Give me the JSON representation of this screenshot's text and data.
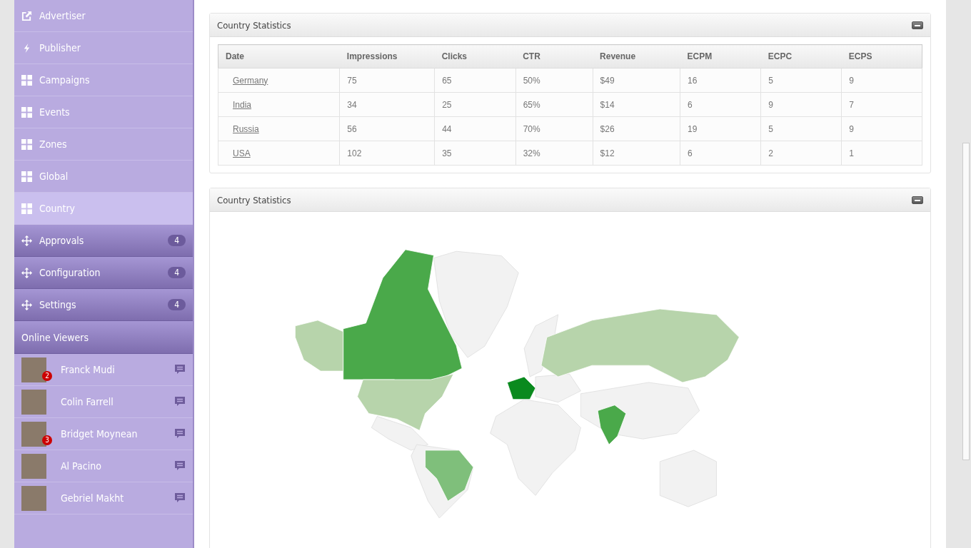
{
  "sidebar": {
    "items": [
      {
        "kind": "link",
        "label": "Advertiser",
        "selected": false
      },
      {
        "kind": "bolt",
        "label": "Publisher",
        "selected": false
      },
      {
        "kind": "grid",
        "label": "Campaigns",
        "selected": false
      },
      {
        "kind": "grid",
        "label": "Events",
        "selected": false
      },
      {
        "kind": "grid",
        "label": "Zones",
        "selected": false
      },
      {
        "kind": "grid",
        "label": "Global",
        "selected": false
      },
      {
        "kind": "grid",
        "label": "Country",
        "selected": true
      },
      {
        "kind": "move",
        "label": "Approvals",
        "badge": "4",
        "selected": false
      },
      {
        "kind": "move",
        "label": "Configuration",
        "badge": "4",
        "selected": false
      },
      {
        "kind": "move",
        "label": "Settings",
        "badge": "4",
        "selected": false
      }
    ],
    "viewers_title": "Online Viewers",
    "viewers": [
      {
        "name": "Franck Mudi",
        "badge": "2"
      },
      {
        "name": "Colin Farrell"
      },
      {
        "name": "Bridget Moynean",
        "badge": "3"
      },
      {
        "name": "Al Pacino"
      },
      {
        "name": "Gebriel Makht"
      }
    ]
  },
  "table_panel": {
    "title": "Country Statistics",
    "columns": [
      "Date",
      "Impressions",
      "Clicks",
      "CTR",
      "Revenue",
      "ECPM",
      "ECPC",
      "ECPS"
    ],
    "rows": [
      [
        "Germany",
        "75",
        "65",
        "50%",
        "$49",
        "16",
        "5",
        "9"
      ],
      [
        "India",
        "34",
        "25",
        "65%",
        "$14",
        "6",
        "9",
        "7"
      ],
      [
        "Russia",
        "56",
        "44",
        "70%",
        "$26",
        "19",
        "5",
        "9"
      ],
      [
        "USA",
        "102",
        "35",
        "32%",
        "$12",
        "6",
        "2",
        "1"
      ]
    ]
  },
  "map_panel": {
    "title": "Country Statistics"
  }
}
